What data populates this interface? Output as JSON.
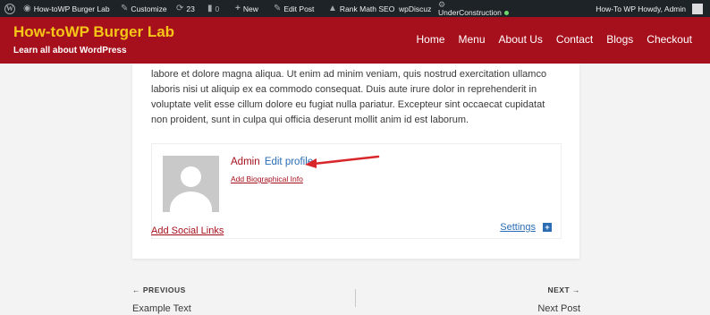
{
  "adminbar": {
    "site_name": "How-toWP Burger Lab",
    "customize": "Customize",
    "updates_count": "23",
    "comments_count": "0",
    "new": "New",
    "edit_post": "Edit Post",
    "rank_math": "Rank Math SEO",
    "wpdiscuz": "wpDiscuz",
    "under_construction": "UnderConstruction",
    "howdy": "How-To WP Howdy, Admin"
  },
  "header": {
    "title": "How-toWP Burger Lab",
    "tagline": "Learn all about WordPress",
    "nav": [
      "Home",
      "Menu",
      "About Us",
      "Contact",
      "Blogs",
      "Checkout"
    ]
  },
  "content": {
    "paragraph": "labore et dolore magna aliqua. Ut enim ad minim veniam, quis nostrud exercitation ullamco laboris nisi ut aliquip ex ea commodo consequat. Duis aute irure dolor in reprehenderit in voluptate velit esse cillum dolore eu fugiat nulla pariatur. Excepteur sint occaecat cupidatat non proident, sunt in culpa qui officia deserunt mollit anim id est laborum."
  },
  "author_box": {
    "name": "Admin",
    "edit_profile": "Edit profile",
    "add_bio": "Add Biographical Info",
    "add_social": "Add Social Links",
    "settings": "Settings"
  },
  "post_nav": {
    "prev_label": "← PREVIOUS",
    "prev_title": "Example Text",
    "next_label": "NEXT →",
    "next_title": "Next Post"
  },
  "colors": {
    "header_bg": "#a60f1c",
    "site_title": "#f5c518",
    "adminbar_bg": "#1d2327",
    "link_blue": "#2a6db5",
    "link_red": "#a60f1c",
    "annotation_arrow": "#d9262b"
  }
}
